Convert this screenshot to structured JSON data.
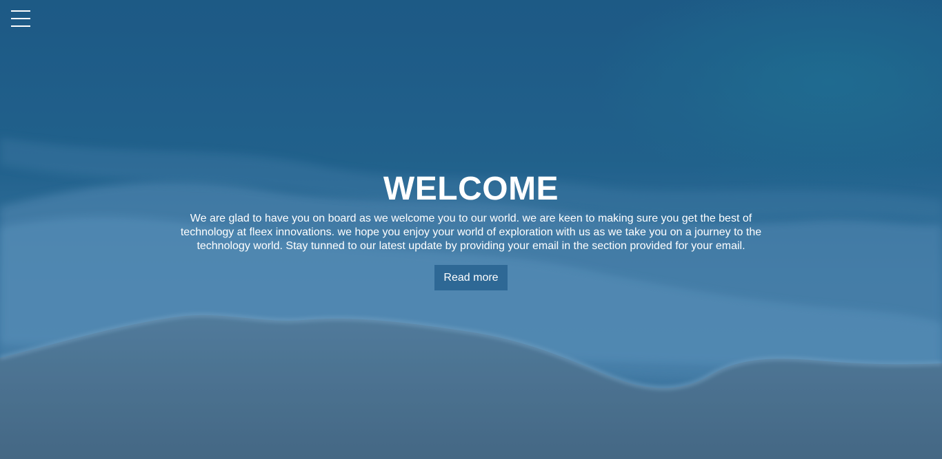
{
  "nav": {
    "menu_icon": "hamburger-menu-icon"
  },
  "hero": {
    "title": "WELCOME",
    "description": "We are glad to have you on board as we welcome you to our world. we are keen to making sure you get the best of technology at fleex innovations. we hope you enjoy your world of exploration with us as we take you on a journey to the technology world. Stay tunned to our latest update by providing your email in the section provided for your email.",
    "button_label": "Read more"
  },
  "colors": {
    "deep_sea": "#1f5c86",
    "foam": "#5b8fb6",
    "sand": "#4d6c86",
    "button": "#2e6895",
    "text": "#ffffff"
  }
}
